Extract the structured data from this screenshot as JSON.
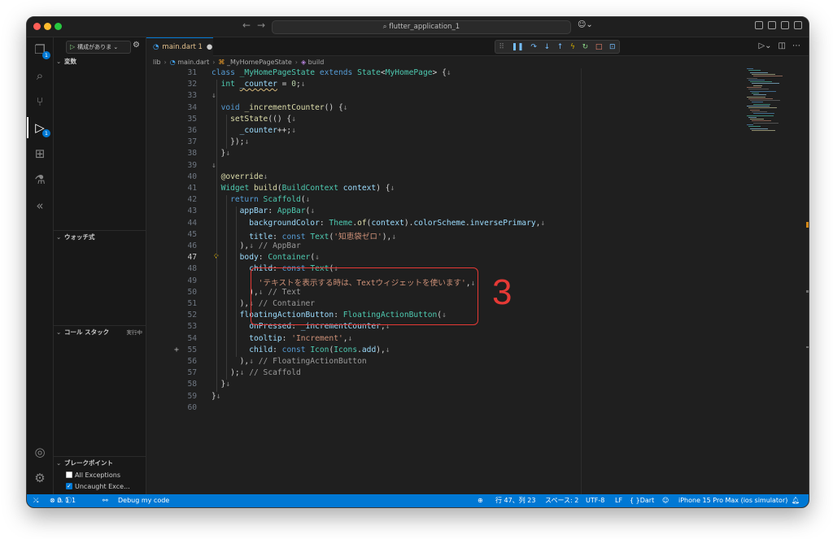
{
  "window": {
    "title": "flutter_application_1",
    "nav_back": "←",
    "nav_forward": "→"
  },
  "activity_bar": {
    "explorer_badge": "1",
    "debug_badge": "1"
  },
  "sidebar": {
    "run_config_label": "構成がありま",
    "variables_title": "変数",
    "watch_title": "ウォッチ式",
    "callstack_title": "コール スタック",
    "callstack_status": "実行中",
    "breakpoints_title": "ブレークポイント",
    "breakpoints": [
      {
        "label": "All Exceptions",
        "checked": false
      },
      {
        "label": "Uncaught Exce...",
        "checked": true
      }
    ]
  },
  "editor": {
    "tab_label": "main.dart 1",
    "breadcrumb": [
      "lib",
      "main.dart",
      "_MyHomePageState",
      "build"
    ],
    "annotation_number": "3"
  },
  "status_bar": {
    "problems": "0",
    "warnings": "1",
    "info": "1",
    "debug_label": "Debug my code",
    "position": "行 47、列 23",
    "spaces": "スペース: 2",
    "encoding": "UTF-8",
    "eol": "LF",
    "language": "Dart",
    "device": "iPhone 15 Pro Max (ios simulator)"
  }
}
